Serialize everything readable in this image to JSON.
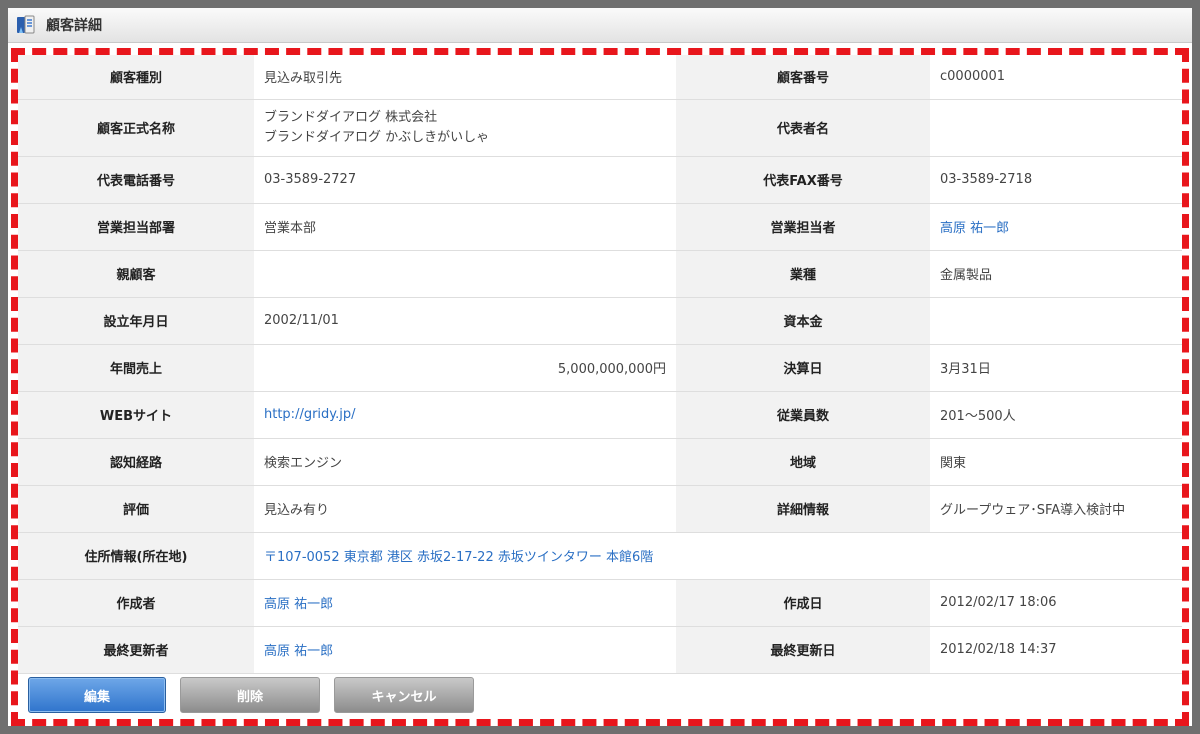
{
  "window": {
    "title": "顧客詳細",
    "app_icon": "customer-book-icon"
  },
  "fields": {
    "customer_type": {
      "label": "顧客種別",
      "value": "見込み取引先"
    },
    "customer_number": {
      "label": "顧客番号",
      "value": "c0000001"
    },
    "official_name": {
      "label": "顧客正式名称",
      "value": "ブランドダイアログ 株式会社",
      "value_kana": "ブランドダイアログ かぶしきがいしゃ"
    },
    "representative": {
      "label": "代表者名",
      "value": ""
    },
    "phone": {
      "label": "代表電話番号",
      "value": "03-3589-2727"
    },
    "fax": {
      "label": "代表FAX番号",
      "value": "03-3589-2718"
    },
    "sales_department": {
      "label": "営業担当部署",
      "value": "営業本部"
    },
    "sales_person": {
      "label": "営業担当者",
      "value": "高原 祐一郎"
    },
    "parent_customer": {
      "label": "親顧客",
      "value": ""
    },
    "industry": {
      "label": "業種",
      "value": "金属製品"
    },
    "founded": {
      "label": "設立年月日",
      "value": "2002/11/01"
    },
    "capital": {
      "label": "資本金",
      "value": ""
    },
    "annual_sales": {
      "label": "年間売上",
      "value": "5,000,000,000円"
    },
    "fiscal_end": {
      "label": "決算日",
      "value": "3月31日"
    },
    "website": {
      "label": "WEBサイト",
      "value": "http://gridy.jp/"
    },
    "employees": {
      "label": "従業員数",
      "value": "201～500人"
    },
    "awareness": {
      "label": "認知経路",
      "value": "検索エンジン"
    },
    "region": {
      "label": "地域",
      "value": "関東"
    },
    "rating": {
      "label": "評価",
      "value": "見込み有り"
    },
    "details": {
      "label": "詳細情報",
      "value": "グループウェア･SFA導入検討中"
    },
    "address": {
      "label": "住所情報(所在地)",
      "value": "〒107-0052 東京都 港区 赤坂2-17-22 赤坂ツインタワー 本館6階"
    },
    "created_by": {
      "label": "作成者",
      "value": "高原 祐一郎"
    },
    "created_at": {
      "label": "作成日",
      "value": "2012/02/17 18:06"
    },
    "updated_by": {
      "label": "最終更新者",
      "value": "高原 祐一郎"
    },
    "updated_at": {
      "label": "最終更新日",
      "value": "2012/02/18 14:37"
    }
  },
  "buttons": {
    "edit": "編集",
    "delete": "削除",
    "cancel": "キャンセル"
  },
  "colors": {
    "highlight_border": "#e8161c",
    "link": "#2a6fc4",
    "primary_button": "#2f74cc"
  }
}
